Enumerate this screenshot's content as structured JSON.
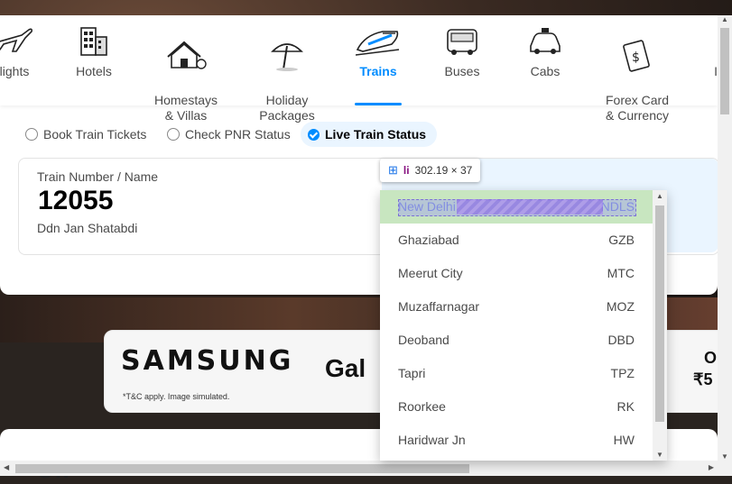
{
  "nav": {
    "items": [
      {
        "label": "lights",
        "icon": "flight-icon"
      },
      {
        "label": "Hotels",
        "icon": "hotel-icon"
      },
      {
        "label": "Homestays\n& Villas",
        "icon": "homestay-icon"
      },
      {
        "label": "Holiday\nPackages",
        "icon": "holiday-icon"
      },
      {
        "label": "Trains",
        "icon": "train-icon",
        "active": true
      },
      {
        "label": "Buses",
        "icon": "bus-icon"
      },
      {
        "label": "Cabs",
        "icon": "cab-icon"
      },
      {
        "label": "Forex Card\n& Currency",
        "icon": "forex-icon"
      },
      {
        "label": "In",
        "icon": "insurance-icon"
      }
    ]
  },
  "radios": {
    "book": "Book Train Tickets",
    "pnr": "Check PNR Status",
    "live": "Live Train Status"
  },
  "train_field": {
    "label": "Train Number / Name",
    "number": "12055",
    "name": "Ddn Jan Shatabdi"
  },
  "tooltip": {
    "tag": "li",
    "dims": "302.19 × 37"
  },
  "stations": [
    {
      "name": "New Delhi",
      "code": "NDLS"
    },
    {
      "name": "Ghaziabad",
      "code": "GZB"
    },
    {
      "name": "Meerut City",
      "code": "MTC"
    },
    {
      "name": "Muzaffarnagar",
      "code": "MOZ"
    },
    {
      "name": "Deoband",
      "code": "DBD"
    },
    {
      "name": "Tapri",
      "code": "TPZ"
    },
    {
      "name": "Roorkee",
      "code": "RK"
    },
    {
      "name": "Haridwar Jn",
      "code": "HW"
    }
  ],
  "banner": {
    "brand": "SAMSUNG",
    "tc": "*T&C apply. Image simulated.",
    "model_fragment": "Gal",
    "price_top": "O",
    "price_fragment": "₹5"
  },
  "offers_fragment": "Off",
  "colors": {
    "accent": "#008cff",
    "highlight_row": "#c8e6c0",
    "devtools_tag": "#881280"
  }
}
